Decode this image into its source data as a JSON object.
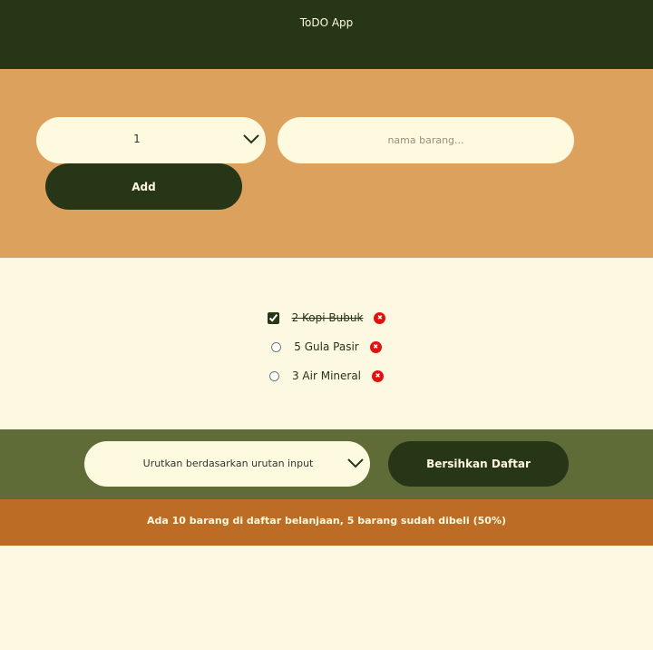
{
  "header": {
    "title": "ToDO App"
  },
  "form": {
    "quantity_value": "1",
    "name_placeholder": "nama barang...",
    "add_label": "Add"
  },
  "items": [
    {
      "quantity": 2,
      "name": "Kopi Bubuk",
      "label": "2 Kopi Bubuk",
      "checked": true
    },
    {
      "quantity": 5,
      "name": "Gula Pasir",
      "label": "5 Gula Pasir",
      "checked": false
    },
    {
      "quantity": 3,
      "name": "Air Mineral",
      "label": "3 Air Mineral",
      "checked": false
    }
  ],
  "actions": {
    "sort_value": "Urutkan berdasarkan urutan input",
    "clear_label": "Bersihkan Daftar"
  },
  "summary": {
    "text": "Ada 10 barang di daftar belanjaan, 5 barang sudah dibeli (50%)"
  },
  "icons": {
    "delete": "close-icon",
    "dropdown": "chevron-down-icon"
  },
  "colors": {
    "header": "#283618",
    "form_band": "#dda15e",
    "stats_band": "#606c38",
    "summary_band": "#bc6c25",
    "background": "#fefae0",
    "delete": "#e21111"
  }
}
